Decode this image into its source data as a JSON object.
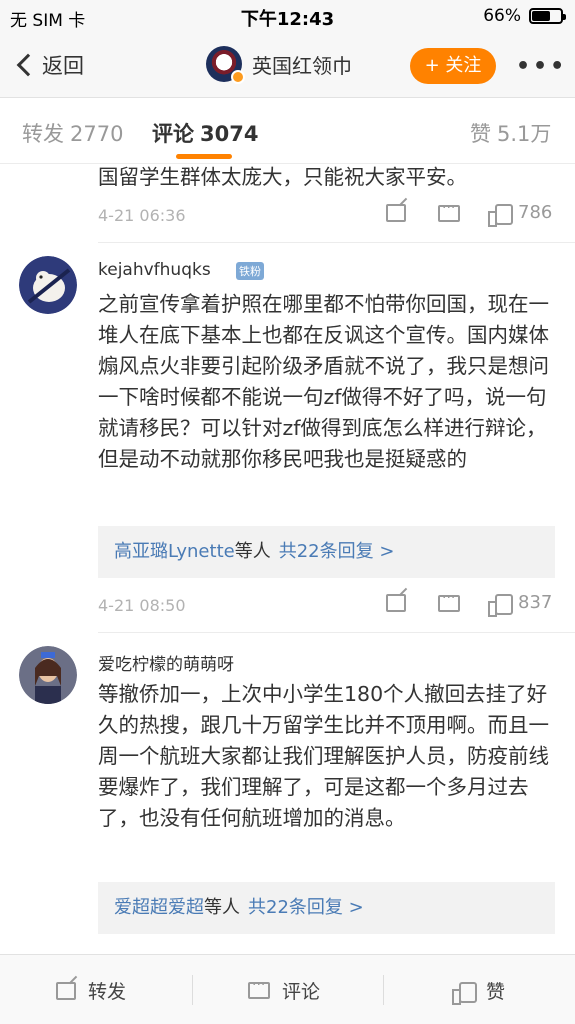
{
  "status_bar": {
    "carrier": "无 SIM 卡",
    "time": "下午12:43",
    "battery_pct": "66%",
    "battery_level": 0.66
  },
  "nav": {
    "back_label": "返回",
    "title": "英国红领巾",
    "follow_label": "+ 关注",
    "more_label": "•••"
  },
  "tabs": [
    {
      "label": "转发",
      "count": "2770"
    },
    {
      "label": "评论",
      "count": "3074"
    },
    {
      "label": "赞",
      "count": "5.1万"
    }
  ],
  "comments": [
    {
      "text": "国留学生群体太庞大，只能祝大家平安。",
      "time": "4-21 06:36",
      "likes": "786"
    },
    {
      "username": "kejahvfhuqks",
      "badge": "铁粉",
      "text": "之前宣传拿着护照在哪里都不怕带你回国，现在一堆人在底下基本上也都在反讽这个宣传。国内媒体煽风点火非要引起阶级矛盾就不说了，我只是想问一下啥时候都不能说一句zf做得不好了吗，说一句就请移民？可以针对zf做得到底怎么样进行辩论，但是动不动就那你移民吧我也是挺疑惑的",
      "reply_names": "高亚璐Lynette",
      "reply_mid": "等人",
      "reply_count": "共22条回复 >",
      "time": "4-21 08:50",
      "likes": "837"
    },
    {
      "username": "爱吃柠檬的萌萌呀",
      "text": "等撤侨加一，上次中小学生180个人撤回去挂了好久的热搜，跟几十万留学生比并不顶用啊。而且一周一个航班大家都让我们理解医护人员，防疫前线要爆炸了，我们理解了，可是这都一个多月过去了，也没有任何航班增加的消息。",
      "reply_names": "爱超超爱超",
      "reply_mid": "等人",
      "reply_count": "共22条回复 >"
    }
  ],
  "bottom_bar": {
    "repost_label": "转发",
    "comment_label": "评论",
    "like_label": "赞"
  },
  "colors": {
    "accent": "#ff8200",
    "link": "#4a7bb5"
  }
}
